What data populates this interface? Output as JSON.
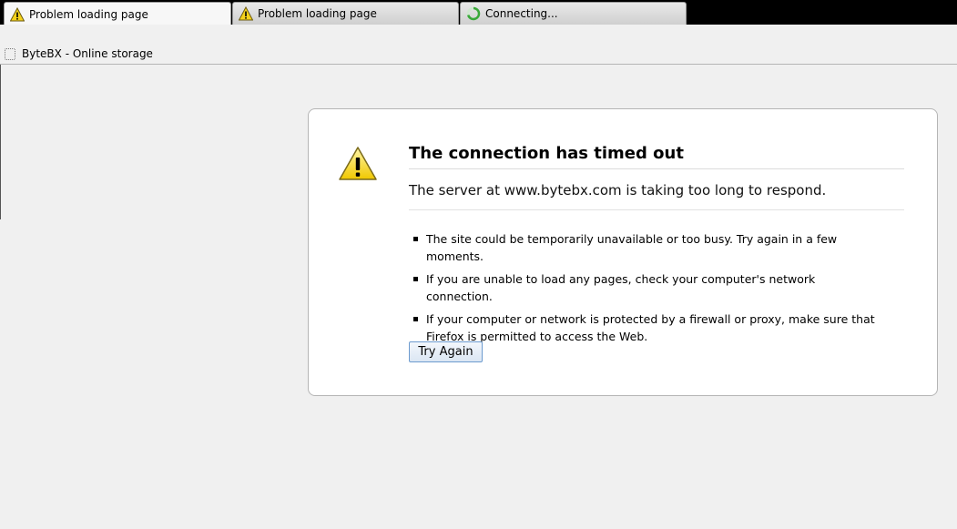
{
  "tabs": [
    {
      "title": "Problem loading page",
      "icon": "warning-icon",
      "active": true
    },
    {
      "title": "Problem loading page",
      "icon": "warning-icon",
      "active": false
    },
    {
      "title": "Connecting...",
      "icon": "loading-spinner-icon",
      "active": false
    }
  ],
  "bookmarks": [
    {
      "label": "ByteBX - Online storage",
      "icon": "page-icon"
    }
  ],
  "error": {
    "title": "The connection has timed out",
    "description": "The server at www.bytebx.com is taking too long to respond.",
    "suggestions": [
      "The site could be temporarily unavailable or too busy. Try again in a few moments.",
      "If you are unable to load any pages, check your computer's network connection.",
      "If your computer or network is protected by a firewall or proxy, make sure that Firefox is permitted to access the Web."
    ],
    "button_label": "Try Again"
  },
  "colors": {
    "warning_yellow": "#f5d21b",
    "spinner_green": "#3aa83a",
    "button_border": "#6d9bcf"
  }
}
